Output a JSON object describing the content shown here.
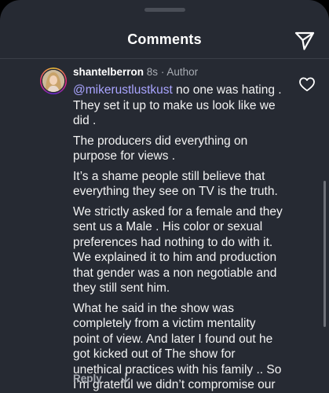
{
  "header": {
    "title": "Comments",
    "send_icon": "send-paper-plane-icon"
  },
  "comment": {
    "username": "shantelberron",
    "time": "8s",
    "separator": "·",
    "role": "Author",
    "mention": "@mikerustlustkust",
    "paragraphs": [
      " no one was hating . They set it up to make us look like we did .",
      "The producers did everything on purpose for views .",
      "It’s a shame people still believe that everything they see on TV is the truth.",
      "We strictly asked for a female and they sent us a Male . His color or sexual preferences had nothing to do with it. We explained it to him and production that gender was a non negotiable and they still sent him.",
      "What he said in the show was completely from a victim mentality point of view. And later I found out he got kicked out of The show for unethical practices with his family .. So I’m grateful we didn’t compromise our values for views"
    ],
    "like_icon": "heart-outline-icon"
  },
  "actions": {
    "reply_label": "Reply",
    "more_icon": "down-arrow-icon"
  },
  "colors": {
    "sheet_background": "#262a33",
    "mention": "#a9a4ff",
    "muted_text": "#a8acb3"
  }
}
